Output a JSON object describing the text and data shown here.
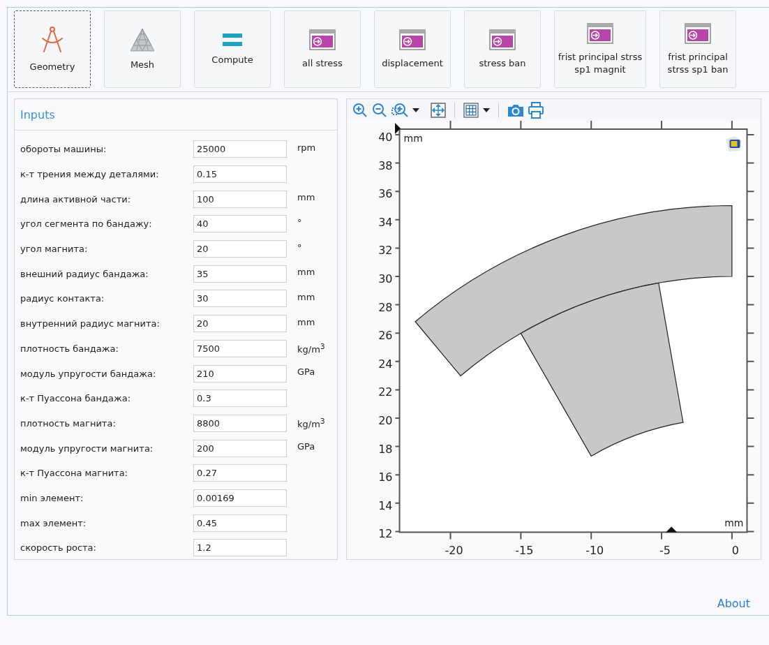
{
  "toolbar": [
    {
      "kind": "geometry",
      "label": "Geometry",
      "focused": true
    },
    {
      "kind": "mesh",
      "label": "Mesh",
      "focused": false
    },
    {
      "kind": "compute",
      "label": "Compute",
      "focused": false
    },
    {
      "kind": "plot",
      "label": "all stress",
      "focused": false
    },
    {
      "kind": "plot",
      "label": "displacement",
      "focused": false
    },
    {
      "kind": "plot",
      "label": "stress ban",
      "focused": false
    },
    {
      "kind": "plot",
      "label": "frist principal strss sp1 magnit",
      "focused": false
    },
    {
      "kind": "plot",
      "label": "frist principal strss sp1 ban",
      "focused": false
    }
  ],
  "inputs": {
    "title": "Inputs",
    "rows": [
      {
        "label": "обороты машины:",
        "value": "25000",
        "unit": "rpm"
      },
      {
        "label": "к-т трения между деталями:",
        "value": "0.15"
      },
      {
        "label": "длина активной части:",
        "value": "100",
        "unit": "mm"
      },
      {
        "label": "угол сегмента по бандажу:",
        "value": "40",
        "unit": "°"
      },
      {
        "label": "угол магнита:",
        "value": "20",
        "unit": "°"
      },
      {
        "label": "внешний радиус бандажа:",
        "value": "35",
        "unit": "mm"
      },
      {
        "label": "радиус контакта:",
        "value": "30",
        "unit": "mm"
      },
      {
        "label": "внутренний радиус магнита:",
        "value": "20",
        "unit": "mm"
      },
      {
        "label": "плотность бандажа:",
        "value": "7500",
        "unit": "kg/m$^{3}$"
      },
      {
        "label": "модуль упругости бандажа:",
        "value": "210",
        "unit": "GPa"
      },
      {
        "label": "к-т Пуассона бандажа:",
        "value": "0.3"
      },
      {
        "label": "плотность магнита:",
        "value": "8800",
        "unit": "kg/m$^{3}$"
      },
      {
        "label": "модуль упругости магнита:",
        "value": "200",
        "unit": "GPa"
      },
      {
        "label": "к-т Пуассона магнита:",
        "value": "0.27"
      },
      {
        "label": "min элемент:",
        "value": "0.00169"
      },
      {
        "label": "max элемент:",
        "value": "0.45"
      },
      {
        "label": "скорость роста:",
        "value": "1.2"
      }
    ]
  },
  "plot": {
    "y_unit": "mm",
    "x_unit": "mm",
    "x_ticks": [
      "-20",
      "-15",
      "-10",
      "-5",
      "0"
    ],
    "y_ticks": [
      "40",
      "38",
      "36",
      "34",
      "32",
      "30",
      "28",
      "26",
      "24",
      "22",
      "20",
      "18",
      "16",
      "14",
      "12"
    ]
  },
  "footer": {
    "link": "About"
  }
}
